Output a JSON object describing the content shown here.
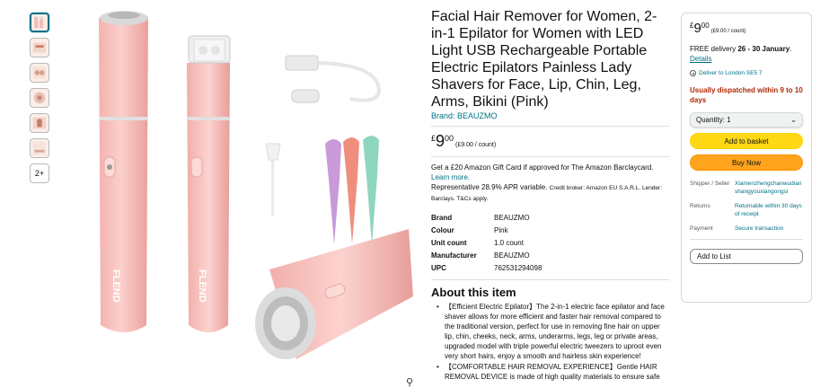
{
  "thumbnails": {
    "items": [
      "thumb-1",
      "thumb-2",
      "thumb-3",
      "thumb-4",
      "thumb-5",
      "thumb-6"
    ],
    "more_label": "2+"
  },
  "main_image": {
    "brand_mark": "FLEND",
    "colors": {
      "device": "#f6b9b5",
      "device_shadow": "#e9a19d",
      "chrome": "#d9d9d9",
      "lilac": "#c89ad8",
      "coral": "#f08e7e",
      "mint": "#8fd6c0"
    }
  },
  "product": {
    "title": "Facial Hair Remover for Women, 2-in-1 Epilator for Women with LED Light USB Rechargeable Portable Electric Epilators Painless Lady Shavers for Face, Lip, Chin, Leg, Arms, Bikini (Pink)",
    "brand_link": "Brand: BEAUZMO",
    "price": {
      "symbol": "£",
      "whole": "9",
      "fraction": "00",
      "per": "(£9.00 / count)"
    },
    "promo_text": "Get a £20 Amazon Gift Card if approved for The Amazon Barclaycard.",
    "promo_link": "Learn more.",
    "apr_text": "Representative 28.9% APR variable.",
    "apr_small": "Credit broker: Amazon EU S.A.R.L. Lender: Barclays. T&Cs apply.",
    "specs": [
      {
        "key": "Brand",
        "value": "BEAUZMO"
      },
      {
        "key": "Colour",
        "value": "Pink"
      },
      {
        "key": "Unit count",
        "value": "1.0 count"
      },
      {
        "key": "Manufacturer",
        "value": "BEAUZMO"
      },
      {
        "key": "UPC",
        "value": "762531294098"
      }
    ],
    "about_heading": "About this item",
    "about_items": [
      "【Efficient Electric Epilator】The 2-in-1 electric face epilator and face shaver allows for more efficient and faster hair removal compared to the traditional version, perfect for use in removing fine hair on upper lip, chin, cheeks, neck, arms, underarms, legs, leg or private areas, upgraded model with triple powerful electric tweezers to uproot even very short hairs, enjoy a smooth and hairless skin experience!",
      "【COMFORTABLE HAIR REMOVAL EXPERIENCE】Gentle HAIR REMOVAL DEVICE is made of high quality materials to ensure safe"
    ]
  },
  "buybox": {
    "price": {
      "symbol": "£",
      "whole": "9",
      "fraction": "00",
      "per": "(£9.00 / count)"
    },
    "delivery_prefix": "FREE delivery",
    "delivery_dates": "26 - 30 January",
    "delivery_suffix": ".",
    "details_link": "Details",
    "deliver_to": "Deliver to London SE5 7",
    "stock_text": "Usually dispatched within 9 to 10 days",
    "quantity_label": "Quantity: 1",
    "add_to_basket": "Add to basket",
    "buy_now": "Buy Now",
    "sold_info": [
      {
        "key": "Shipper / Seller",
        "value": "Xiamenzhengchanwudianshangyouxiangongsi"
      },
      {
        "key": "Returns",
        "value": "Returnable within 30 days of receipt"
      },
      {
        "key": "Payment",
        "value": "Secure transaction"
      }
    ],
    "add_to_list": "Add to List"
  },
  "colors": {
    "link": "#007185",
    "stock": "#b12704",
    "basket": "#ffd814",
    "buy": "#ffa41c"
  }
}
